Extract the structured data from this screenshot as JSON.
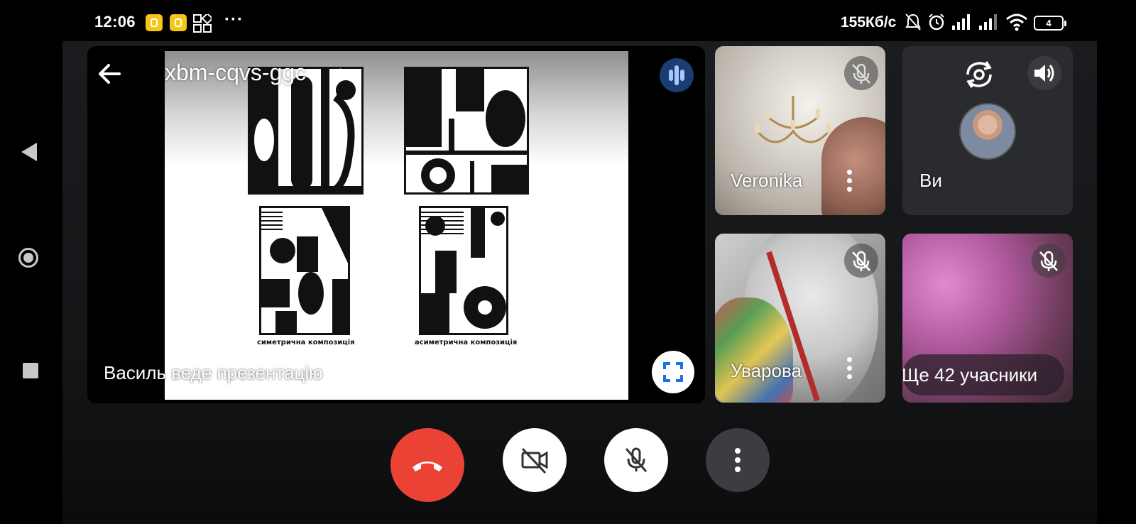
{
  "status_bar": {
    "time": "12:06",
    "network_speed": "155Кб/с",
    "battery_level": "4",
    "icons": [
      "notification-icon",
      "notification-icon",
      "apps-icon",
      "more-dots",
      "mute-bell-icon",
      "alarm-icon",
      "signal-icon",
      "signal-icon",
      "wifi-icon",
      "battery-icon"
    ]
  },
  "meeting": {
    "code": "xbm-cqvs-ggc",
    "presenter_label": "Василь веде презентацію"
  },
  "slide": {
    "captions": [
      "симетрична композиція",
      "асиметрична композиція"
    ]
  },
  "participants": [
    {
      "name": "Veronika",
      "muted": true
    },
    {
      "name": "Ви",
      "muted": false
    },
    {
      "name": "Уварова",
      "muted": true
    }
  ],
  "more_participants": "Ще 42 учасники",
  "colors": {
    "end_call": "#ea4335",
    "speaking_indicator": "#1a3d74",
    "background": "#000000"
  }
}
